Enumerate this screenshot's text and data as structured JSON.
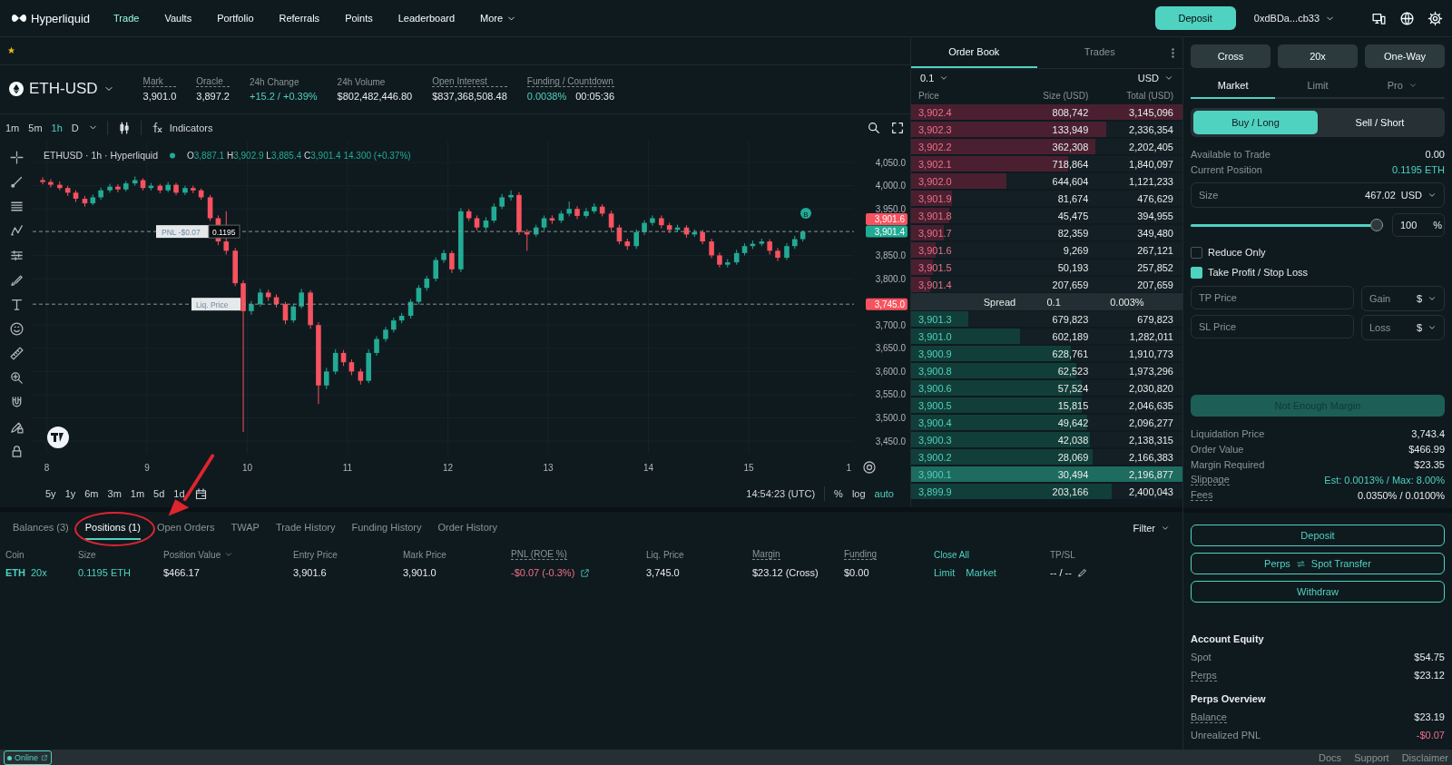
{
  "nav": {
    "logo_text": "Hyperliquid",
    "items": [
      {
        "label": "Trade",
        "selected": true,
        "dropdown": false
      },
      {
        "label": "Vaults",
        "selected": false,
        "dropdown": false
      },
      {
        "label": "Portfolio",
        "selected": false,
        "dropdown": false
      },
      {
        "label": "Referrals",
        "selected": false,
        "dropdown": false
      },
      {
        "label": "Points",
        "selected": false,
        "dropdown": false
      },
      {
        "label": "Leaderboard",
        "selected": false,
        "dropdown": false
      },
      {
        "label": "More",
        "selected": false,
        "dropdown": true
      }
    ],
    "deposit": "Deposit",
    "wallet": "0xdBDa...cb33"
  },
  "market": {
    "symbol": "ETH-USD",
    "stats": [
      {
        "label": "Mark",
        "underlined": true,
        "values": [
          {
            "text": "3,901.0",
            "kind": "neutral"
          }
        ]
      },
      {
        "label": "Oracle",
        "underlined": true,
        "values": [
          {
            "text": "3,897.2",
            "kind": "neutral"
          }
        ]
      },
      {
        "label": "24h Change",
        "underlined": false,
        "values": [
          {
            "text": "+15.2 / +0.39%",
            "kind": "up"
          }
        ]
      },
      {
        "label": "24h Volume",
        "underlined": false,
        "values": [
          {
            "text": "$802,482,446.80",
            "kind": "neutral"
          }
        ]
      },
      {
        "label": "Open Interest",
        "underlined": true,
        "values": [
          {
            "text": "$837,368,508.48",
            "kind": "neutral"
          }
        ]
      },
      {
        "label": "Funding / Countdown",
        "underlined": true,
        "values": [
          {
            "text": "0.0038%",
            "kind": "up"
          },
          {
            "text": "00:05:36",
            "kind": "neutral"
          }
        ]
      }
    ]
  },
  "chart": {
    "intervals": [
      {
        "label": "1m",
        "selected": false
      },
      {
        "label": "5m",
        "selected": false
      },
      {
        "label": "1h",
        "selected": true
      },
      {
        "label": "D",
        "selected": false
      }
    ],
    "indicators": "Indicators",
    "legend": {
      "title": "ETHUSD · 1h · Hyperliquid",
      "ohlc": [
        {
          "key": "O",
          "value": "3,887.1"
        },
        {
          "key": "H",
          "value": "3,902.9"
        },
        {
          "key": "L",
          "value": "3,885.4"
        },
        {
          "key": "C",
          "value": "3,901.4"
        }
      ],
      "change": "14.300 (+0.37%)"
    },
    "chart_data": {
      "type": "candlestick",
      "x": [
        7.96,
        8.04,
        8.13,
        8.21,
        8.29,
        8.38,
        8.46,
        8.54,
        8.63,
        8.71,
        8.79,
        8.88,
        8.96,
        9.04,
        9.13,
        9.21,
        9.29,
        9.38,
        9.46,
        9.54,
        9.63,
        9.71,
        9.79,
        9.88,
        9.96,
        10.04,
        10.13,
        10.21,
        10.29,
        10.38,
        10.46,
        10.54,
        10.63,
        10.71,
        10.79,
        10.88,
        10.96,
        11.04,
        11.13,
        11.21,
        11.29,
        11.38,
        11.46,
        11.54,
        11.63,
        11.71,
        11.79,
        11.88,
        11.96,
        12.04,
        12.13,
        12.21,
        12.29,
        12.38,
        12.46,
        12.54,
        12.63,
        12.71,
        12.79,
        12.88,
        12.96,
        13.04,
        13.13,
        13.21,
        13.29,
        13.38,
        13.46,
        13.54,
        13.63,
        13.71,
        13.79,
        13.88,
        13.96,
        14.04,
        14.13,
        14.21,
        14.29,
        14.38,
        14.46,
        14.54,
        14.63,
        14.71,
        14.79,
        14.88,
        14.96,
        15.04,
        15.13,
        15.21,
        15.29,
        15.38,
        15.46,
        15.54
      ],
      "ohlc": [
        [
          4012,
          4018,
          4003,
          4008
        ],
        [
          4008,
          4014,
          3996,
          4002
        ],
        [
          4002,
          4009,
          3990,
          3995
        ],
        [
          3995,
          4000,
          3978,
          3985
        ],
        [
          3985,
          3990,
          3965,
          3972
        ],
        [
          3972,
          3978,
          3955,
          3962
        ],
        [
          3962,
          3981,
          3958,
          3975
        ],
        [
          3975,
          3996,
          3970,
          3990
        ],
        [
          3990,
          4004,
          3985,
          3998
        ],
        [
          3998,
          4003,
          3986,
          3992
        ],
        [
          3992,
          4010,
          3988,
          4005
        ],
        [
          4005,
          4020,
          4000,
          4012
        ],
        [
          4012,
          4016,
          3990,
          3995
        ],
        [
          3995,
          4006,
          3990,
          4000
        ],
        [
          4000,
          4004,
          3984,
          3990
        ],
        [
          3990,
          4008,
          3986,
          4002
        ],
        [
          4002,
          4006,
          3980,
          3985
        ],
        [
          3985,
          4000,
          3980,
          3995
        ],
        [
          3995,
          4000,
          3984,
          3990
        ],
        [
          3990,
          3994,
          3970,
          3975
        ],
        [
          3975,
          3980,
          3924,
          3930
        ],
        [
          3930,
          3936,
          3872,
          3880
        ],
        [
          3880,
          3945,
          3852,
          3860
        ],
        [
          3860,
          3866,
          3784,
          3790
        ],
        [
          3790,
          3796,
          3470,
          3730
        ],
        [
          3730,
          3752,
          3722,
          3745
        ],
        [
          3745,
          3778,
          3740,
          3770
        ],
        [
          3770,
          3776,
          3752,
          3760
        ],
        [
          3760,
          3766,
          3738,
          3745
        ],
        [
          3745,
          3750,
          3702,
          3710
        ],
        [
          3710,
          3746,
          3705,
          3740
        ],
        [
          3740,
          3778,
          3735,
          3770
        ],
        [
          3770,
          3775,
          3692,
          3700
        ],
        [
          3700,
          3706,
          3530,
          3570
        ],
        [
          3570,
          3608,
          3562,
          3600
        ],
        [
          3600,
          3648,
          3594,
          3640
        ],
        [
          3640,
          3646,
          3612,
          3620
        ],
        [
          3620,
          3626,
          3592,
          3600
        ],
        [
          3600,
          3606,
          3572,
          3580
        ],
        [
          3580,
          3648,
          3575,
          3640
        ],
        [
          3640,
          3676,
          3634,
          3670
        ],
        [
          3670,
          3696,
          3664,
          3690
        ],
        [
          3690,
          3716,
          3684,
          3710
        ],
        [
          3710,
          3726,
          3704,
          3720
        ],
        [
          3720,
          3756,
          3714,
          3750
        ],
        [
          3750,
          3786,
          3744,
          3780
        ],
        [
          3780,
          3806,
          3774,
          3800
        ],
        [
          3800,
          3846,
          3794,
          3840
        ],
        [
          3840,
          3862,
          3834,
          3855
        ],
        [
          3855,
          3860,
          3812,
          3820
        ],
        [
          3820,
          3952,
          3814,
          3945
        ],
        [
          3945,
          3950,
          3924,
          3930
        ],
        [
          3930,
          3936,
          3904,
          3910
        ],
        [
          3910,
          3932,
          3904,
          3925
        ],
        [
          3925,
          3962,
          3920,
          3955
        ],
        [
          3955,
          3982,
          3950,
          3975
        ],
        [
          3975,
          3990,
          3968,
          3980
        ],
        [
          3980,
          3986,
          3894,
          3900
        ],
        [
          3900,
          3906,
          3860,
          3895
        ],
        [
          3895,
          3916,
          3890,
          3910
        ],
        [
          3910,
          3936,
          3904,
          3930
        ],
        [
          3930,
          3936,
          3918,
          3925
        ],
        [
          3925,
          3946,
          3920,
          3940
        ],
        [
          3940,
          3966,
          3934,
          3950
        ],
        [
          3950,
          3956,
          3928,
          3935
        ],
        [
          3935,
          3952,
          3930,
          3945
        ],
        [
          3945,
          3962,
          3940,
          3955
        ],
        [
          3955,
          3960,
          3934,
          3940
        ],
        [
          3940,
          3946,
          3904,
          3910
        ],
        [
          3910,
          3916,
          3874,
          3880
        ],
        [
          3880,
          3886,
          3862,
          3870
        ],
        [
          3870,
          3906,
          3864,
          3900
        ],
        [
          3900,
          3926,
          3894,
          3920
        ],
        [
          3920,
          3936,
          3914,
          3930
        ],
        [
          3930,
          3936,
          3908,
          3915
        ],
        [
          3915,
          3920,
          3898,
          3905
        ],
        [
          3905,
          3916,
          3900,
          3910
        ],
        [
          3910,
          3915,
          3888,
          3895
        ],
        [
          3895,
          3906,
          3890,
          3900
        ],
        [
          3900,
          3905,
          3874,
          3880
        ],
        [
          3880,
          3886,
          3844,
          3850
        ],
        [
          3850,
          3856,
          3824,
          3830
        ],
        [
          3830,
          3842,
          3824,
          3835
        ],
        [
          3835,
          3862,
          3830,
          3855
        ],
        [
          3855,
          3876,
          3850,
          3870
        ],
        [
          3870,
          3882,
          3864,
          3875
        ],
        [
          3875,
          3886,
          3870,
          3880
        ],
        [
          3880,
          3885,
          3852,
          3860
        ],
        [
          3860,
          3866,
          3838,
          3845
        ],
        [
          3845,
          3876,
          3840,
          3870
        ],
        [
          3870,
          3892,
          3864,
          3885
        ],
        [
          3885,
          3903,
          3880,
          3901
        ]
      ],
      "xlim": [
        7.86,
        16.05
      ],
      "ylim": [
        3423,
        4097
      ],
      "grid": true,
      "xticks": [
        8,
        9,
        10,
        11,
        12,
        13,
        14,
        15
      ],
      "yticks": [
        {
          "value": 4050,
          "label": "4,050.0"
        },
        {
          "value": 4000,
          "label": "4,000.0"
        },
        {
          "value": 3950,
          "label": "3,950.0"
        },
        {
          "value": 3850,
          "label": "3,850.0"
        },
        {
          "value": 3800,
          "label": "3,800.0"
        },
        {
          "value": 3700,
          "label": "3,700.0"
        },
        {
          "value": 3650,
          "label": "3,650.0"
        },
        {
          "value": 3600,
          "label": "3,600.0"
        },
        {
          "value": 3550,
          "label": "3,550.0"
        },
        {
          "value": 3500,
          "label": "3,500.0"
        },
        {
          "value": 3450,
          "label": "3,450.0"
        }
      ]
    },
    "edge_label": "1",
    "price_lines": [
      {
        "kind": "position",
        "label": "PNL -$0.07",
        "size": "0.1195",
        "price": "3,901.4"
      },
      {
        "kind": "liquidation",
        "label": "Liq. Price",
        "price": "3,745.0"
      }
    ],
    "axis_tags": [
      {
        "kind": "ask",
        "text": "3,901.6"
      }
    ],
    "marker": "B",
    "ranges": [
      "5y",
      "1y",
      "6m",
      "3m",
      "1m",
      "5d",
      "1d"
    ],
    "clock": "14:54:23 (UTC)",
    "scale_options": [
      {
        "label": "%",
        "selected": false
      },
      {
        "label": "log",
        "selected": false
      },
      {
        "label": "auto",
        "selected": true
      }
    ]
  },
  "order_book": {
    "tabs": [
      {
        "label": "Order Book",
        "selected": true
      },
      {
        "label": "Trades",
        "selected": false
      }
    ],
    "tick": "0.1",
    "unit": "USD",
    "columns": [
      "Price",
      "Size (USD)",
      "Total (USD)"
    ],
    "asks": [
      {
        "price": "3,902.4",
        "size": "808,742",
        "total": "3,145,096",
        "level": 1,
        "highlighted": false
      },
      {
        "price": "3,902.3",
        "size": "133,949",
        "total": "2,336,354",
        "level": 0.72,
        "highlighted": false
      },
      {
        "price": "3,902.2",
        "size": "362,308",
        "total": "2,202,405",
        "level": 0.68,
        "highlighted": false
      },
      {
        "price": "3,902.1",
        "size": "718,864",
        "total": "1,840,097",
        "level": 0.58,
        "highlighted": false
      },
      {
        "price": "3,902.0",
        "size": "644,604",
        "total": "1,121,233",
        "level": 0.35,
        "highlighted": false
      },
      {
        "price": "3,901.9",
        "size": "81,674",
        "total": "476,629",
        "level": 0.15,
        "highlighted": false
      },
      {
        "price": "3,901.8",
        "size": "45,475",
        "total": "394,955",
        "level": 0.14,
        "highlighted": false
      },
      {
        "price": "3,901.7",
        "size": "82,359",
        "total": "349,480",
        "level": 0.12,
        "highlighted": false
      },
      {
        "price": "3,901.6",
        "size": "9,269",
        "total": "267,121",
        "level": 0.09,
        "highlighted": false
      },
      {
        "price": "3,901.5",
        "size": "50,193",
        "total": "257,852",
        "level": 0.08,
        "highlighted": false
      },
      {
        "price": "3,901.4",
        "size": "207,659",
        "total": "207,659",
        "level": 0.07,
        "highlighted": false
      }
    ],
    "spread": {
      "label": "Spread",
      "value": "0.1",
      "percent": "0.003%"
    },
    "bids": [
      {
        "price": "3,901.3",
        "size": "679,823",
        "total": "679,823",
        "level": 0.21,
        "highlighted": false
      },
      {
        "price": "3,901.0",
        "size": "602,189",
        "total": "1,282,011",
        "level": 0.4,
        "highlighted": false
      },
      {
        "price": "3,900.9",
        "size": "628,761",
        "total": "1,910,773",
        "level": 0.59,
        "highlighted": false
      },
      {
        "price": "3,900.8",
        "size": "62,523",
        "total": "1,973,296",
        "level": 0.61,
        "highlighted": false
      },
      {
        "price": "3,900.6",
        "size": "57,524",
        "total": "2,030,820",
        "level": 0.63,
        "highlighted": false
      },
      {
        "price": "3,900.5",
        "size": "15,815",
        "total": "2,046,635",
        "level": 0.63,
        "highlighted": false
      },
      {
        "price": "3,900.4",
        "size": "49,642",
        "total": "2,096,277",
        "level": 0.65,
        "highlighted": false
      },
      {
        "price": "3,900.3",
        "size": "42,038",
        "total": "2,138,315",
        "level": 0.66,
        "highlighted": false
      },
      {
        "price": "3,900.2",
        "size": "28,069",
        "total": "2,166,383",
        "level": 0.67,
        "highlighted": false
      },
      {
        "price": "3,900.1",
        "size": "30,494",
        "total": "2,196,877",
        "level": 1,
        "highlighted": true
      },
      {
        "price": "3,899.9",
        "size": "203,166",
        "total": "2,400,043",
        "level": 0.74,
        "highlighted": false
      }
    ]
  },
  "positions_panel": {
    "tabs": [
      {
        "label": "Balances (3)",
        "selected": false,
        "circled": false
      },
      {
        "label": "Positions (1)",
        "selected": true,
        "circled": true
      },
      {
        "label": "Open Orders",
        "selected": false,
        "circled": false
      },
      {
        "label": "TWAP",
        "selected": false,
        "circled": false
      },
      {
        "label": "Trade History",
        "selected": false,
        "circled": false
      },
      {
        "label": "Funding History",
        "selected": false,
        "circled": false
      },
      {
        "label": "Order History",
        "selected": false,
        "circled": false
      }
    ],
    "filter": "Filter",
    "columns": [
      {
        "label": "Coin",
        "kind": "plain"
      },
      {
        "label": "Size",
        "kind": "plain"
      },
      {
        "label": "Position Value",
        "kind": "sort"
      },
      {
        "label": "Entry Price",
        "kind": "plain"
      },
      {
        "label": "Mark Price",
        "kind": "plain"
      },
      {
        "label": "PNL (ROE %)",
        "kind": "underlined"
      },
      {
        "label": "Liq. Price",
        "kind": "plain"
      },
      {
        "label": "Margin",
        "kind": "underlined"
      },
      {
        "label": "Funding",
        "kind": "underlined"
      },
      {
        "label": "Close All",
        "kind": "action"
      },
      {
        "label": "TP/SL",
        "kind": "plain"
      }
    ],
    "rows": [
      {
        "coin": "ETH",
        "leverage": "20x",
        "size": "0.1195 ETH",
        "value": "$466.17",
        "entry": "3,901.6",
        "mark": "3,901.0",
        "pnl": "-$0.07 (-0.3%)",
        "liq": "3,745.0",
        "margin": "$23.12 (Cross)",
        "funding": "$0.00",
        "close_actions": [
          "Limit",
          "Market"
        ],
        "tpsl": "-- / --"
      }
    ]
  },
  "order_form": {
    "mode_buttons": [
      "Cross",
      "20x",
      "One-Way"
    ],
    "order_tabs": [
      {
        "label": "Market",
        "selected": true,
        "dropdown": false
      },
      {
        "label": "Limit",
        "selected": false,
        "dropdown": false
      },
      {
        "label": "Pro",
        "selected": false,
        "dropdown": true
      }
    ],
    "sides": [
      {
        "label": "Buy / Long",
        "selected": true
      },
      {
        "label": "Sell / Short",
        "selected": false
      }
    ],
    "info": [
      {
        "label": "Available to Trade",
        "value": "0.00",
        "kind": "neutral"
      },
      {
        "label": "Current Position",
        "value": "0.1195 ETH",
        "kind": "up"
      }
    ],
    "size": {
      "label": "Size",
      "value": "467.02",
      "unit": "USD"
    },
    "slider": {
      "level": 1,
      "value": "100",
      "unit": "%"
    },
    "checks": [
      {
        "label": "Reduce Only",
        "checked": false
      },
      {
        "label": "Take Profit / Stop Loss",
        "checked": true
      }
    ],
    "tpsl": [
      {
        "placeholder": "TP Price",
        "mode": "Gain",
        "unit": "$"
      },
      {
        "placeholder": "SL Price",
        "mode": "Loss",
        "unit": "$"
      }
    ],
    "submit": {
      "label": "Not Enough Margin",
      "disabled": true
    },
    "details": [
      {
        "label": "Liquidation Price",
        "value": "3,743.4",
        "underlined": false,
        "kind": "neutral"
      },
      {
        "label": "Order Value",
        "value": "$466.99",
        "underlined": false,
        "kind": "neutral"
      },
      {
        "label": "Margin Required",
        "value": "$23.35",
        "underlined": false,
        "kind": "neutral"
      },
      {
        "label": "Slippage",
        "value": "Est: 0.0013% / Max: 8.00%",
        "underlined": true,
        "kind": "up"
      },
      {
        "label": "Fees",
        "value": "0.0350% / 0.0100%",
        "underlined": true,
        "kind": "neutral"
      }
    ]
  },
  "account": {
    "buttons": [
      {
        "kind": "plain",
        "label": "Deposit"
      },
      {
        "kind": "transfer",
        "from": "Perps",
        "to": "Spot Transfer"
      },
      {
        "kind": "plain",
        "label": "Withdraw"
      }
    ],
    "sections": [
      {
        "title": "Account Equity",
        "rows": [
          {
            "label": "Spot",
            "value": "$54.75",
            "underlined": false,
            "kind": "neutral"
          },
          {
            "label": "Perps",
            "value": "$23.12",
            "underlined": true,
            "kind": "neutral"
          }
        ]
      },
      {
        "title": "Perps Overview",
        "rows": [
          {
            "label": "Balance",
            "value": "$23.19",
            "underlined": true,
            "kind": "neutral"
          },
          {
            "label": "Unrealized PNL",
            "value": "-$0.07",
            "underlined": false,
            "kind": "down"
          }
        ]
      }
    ]
  },
  "status_bar": {
    "online": "Online",
    "links": [
      "Docs",
      "Support",
      "Disclaimer"
    ]
  },
  "markup": [
    {
      "kind": "arrow"
    }
  ]
}
